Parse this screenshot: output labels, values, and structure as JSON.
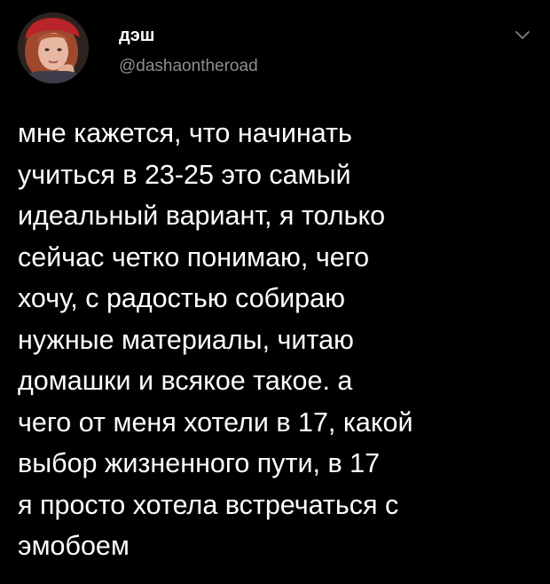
{
  "tweet": {
    "author": {
      "display_name": "дэш",
      "handle": "@dashaontheroad",
      "avatar_icon": "profile-photo"
    },
    "menu_icon": "chevron-down-icon",
    "text_lines": [
      "мне кажется, что начинать",
      "учиться в 23-25 это самый",
      "идеальный вариант, я только",
      "сейчас четко понимаю, чего",
      "хочу, с радостью собираю",
      "нужные материалы, читаю",
      "домашки и всякое такое. а",
      "чего от меня хотели в 17, какой",
      "выбор жизненного пути, в 17",
      "я просто хотела встречаться с",
      "эмобоем"
    ]
  },
  "colors": {
    "background": "#000000",
    "text": "#ffffff",
    "secondary_text": "#8a8f94"
  }
}
